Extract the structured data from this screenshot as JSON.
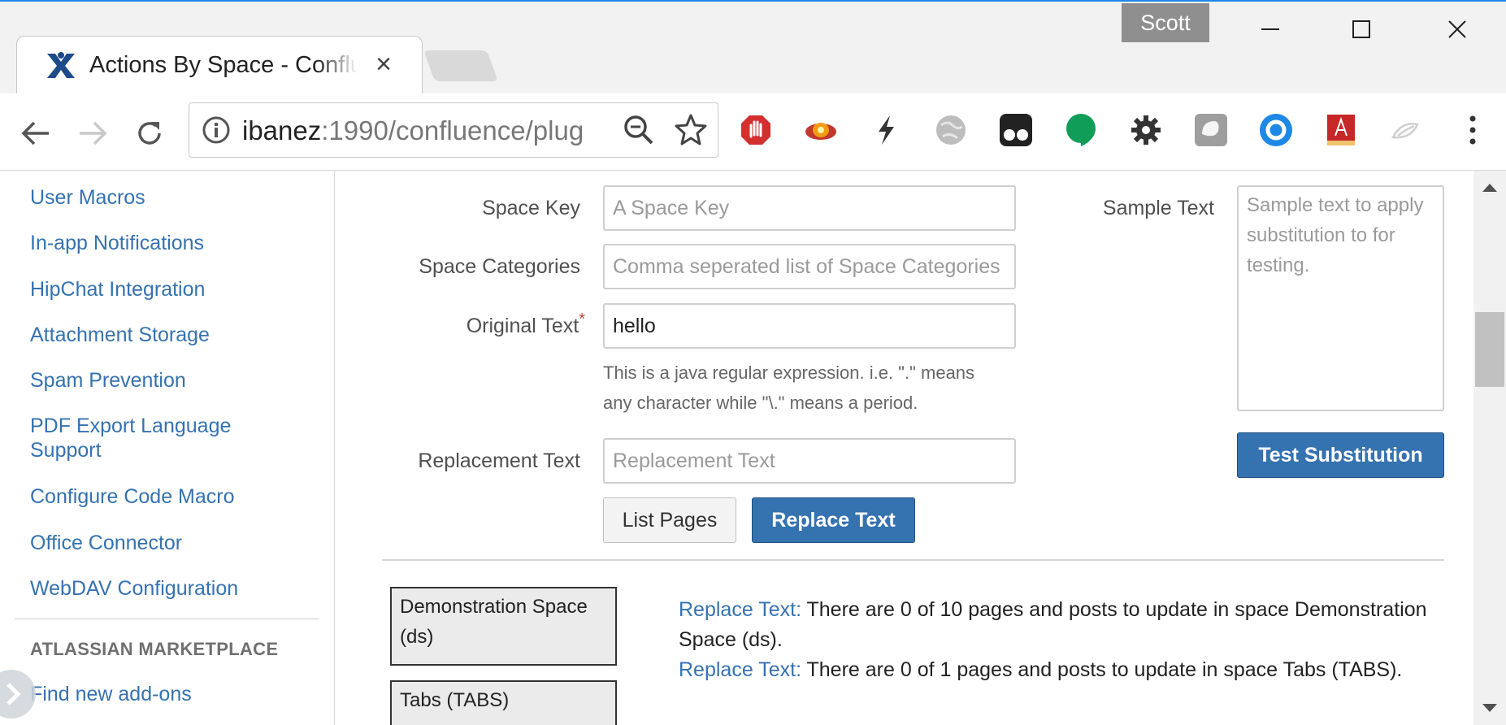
{
  "window": {
    "profile_name": "Scott"
  },
  "tab": {
    "title": "Actions By Space - Confluence",
    "close_glyph": "×"
  },
  "omnibox": {
    "host": "ibanez",
    "rest": ":1990/confluence/plug"
  },
  "extensions": [
    "adblock-icon",
    "fox-icon",
    "bolt-icon",
    "globe-icon",
    "tampermonkey-icon",
    "hangouts-icon",
    "gear-icon",
    "pocket-icon",
    "o-icon",
    "book-icon",
    "leaf-icon"
  ],
  "sidebar": {
    "items": [
      {
        "label": "User Macros"
      },
      {
        "label": "In-app Notifications"
      },
      {
        "label": "HipChat Integration"
      },
      {
        "label": "Attachment Storage"
      },
      {
        "label": "Spam Prevention"
      },
      {
        "label": "PDF Export Language Support"
      },
      {
        "label": "Configure Code Macro"
      },
      {
        "label": "Office Connector"
      },
      {
        "label": "WebDAV Configuration"
      }
    ],
    "marketplace_heading": "ATLASSIAN MARKETPLACE",
    "marketplace_items": [
      {
        "label": "Find new add-ons"
      }
    ]
  },
  "form": {
    "space_key": {
      "label": "Space Key",
      "placeholder": "A Space Key",
      "value": ""
    },
    "space_categories": {
      "label": "Space Categories",
      "placeholder": "Comma seperated list of Space Categories",
      "value": ""
    },
    "original_text": {
      "label": "Original Text",
      "required_mark": "*",
      "value": "hello",
      "help": "This is a java regular expression. i.e. \".\" means any character while \"\\.\" means a period."
    },
    "replacement_text": {
      "label": "Replacement Text",
      "placeholder": "Replacement Text",
      "value": ""
    },
    "sample_text": {
      "label": "Sample Text",
      "placeholder": "Sample text to apply substitution to for testing."
    },
    "list_pages_label": "List Pages",
    "replace_text_label": "Replace Text",
    "test_substitution_label": "Test Substitution"
  },
  "results": {
    "spaces": [
      {
        "name": "Demonstration Space (ds)"
      },
      {
        "name": "Tabs (TABS)"
      }
    ],
    "messages": [
      {
        "link": "Replace Text:",
        "text": " There are 0 of 10 pages and posts to update in space Demonstration Space (ds)."
      },
      {
        "link": "Replace Text:",
        "text": " There are 0 of 1 pages and posts to update in space Tabs (TABS)."
      }
    ]
  },
  "colors": {
    "link": "#3572b0",
    "primary_button": "#3572b0",
    "required": "#d04437"
  }
}
